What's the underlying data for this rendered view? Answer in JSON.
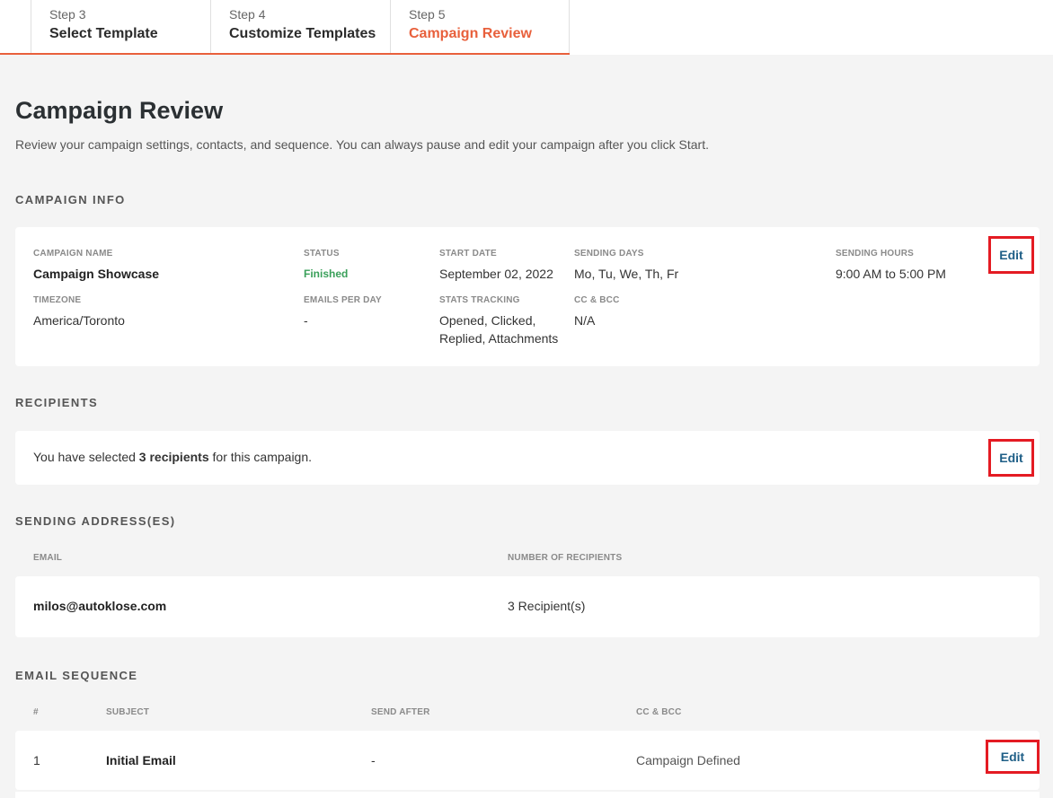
{
  "stepper": {
    "steps": [
      {
        "number": "Step 3",
        "title": "Select Template"
      },
      {
        "number": "Step 4",
        "title": "Customize Templates"
      },
      {
        "number": "Step 5",
        "title": "Campaign Review"
      }
    ],
    "active_color": "#e8603c"
  },
  "page": {
    "title": "Campaign Review",
    "subtitle": "Review your campaign settings, contacts, and sequence. You can always pause and edit your campaign after you click Start."
  },
  "campaign_info": {
    "section_title": "CAMPAIGN INFO",
    "name_label": "CAMPAIGN NAME",
    "name_value": "Campaign Showcase",
    "status_label": "STATUS",
    "status_value": "Finished",
    "status_color": "#3aa05a",
    "start_date_label": "START DATE",
    "start_date_value": "September 02, 2022",
    "sending_days_label": "SENDING DAYS",
    "sending_days_value": "Mo, Tu, We, Th, Fr",
    "sending_hours_label": "SENDING HOURS",
    "sending_hours_value": "9:00 AM to 5:00 PM",
    "timezone_label": "TIMEZONE",
    "timezone_value": "America/Toronto",
    "emails_per_day_label": "EMAILS PER DAY",
    "emails_per_day_value": "-",
    "stats_tracking_label": "STATS TRACKING",
    "stats_tracking_value": "Opened, Clicked, Replied, Attachments",
    "cc_bcc_label": "CC & BCC",
    "cc_bcc_value": "N/A",
    "edit_label": "Edit"
  },
  "recipients": {
    "section_title": "RECIPIENTS",
    "text_before": "You have selected ",
    "count_text": "3 recipients",
    "text_after": " for this campaign.",
    "edit_label": "Edit"
  },
  "sending_addresses": {
    "section_title": "SENDING ADDRESS(ES)",
    "columns": [
      "EMAIL",
      "NUMBER OF RECIPIENTS"
    ],
    "rows": [
      {
        "email": "milos@autoklose.com",
        "recipients": "3 Recipient(s)"
      }
    ]
  },
  "email_sequence": {
    "section_title": "EMAIL SEQUENCE",
    "columns": [
      "#",
      "SUBJECT",
      "SEND AFTER",
      "CC & BCC"
    ],
    "rows": [
      {
        "index": "1",
        "subject": "Initial Email",
        "send_after": "-",
        "cc_bcc": "Campaign Defined",
        "edit_label": "Edit"
      }
    ]
  },
  "highlight_color": "#e41b23"
}
